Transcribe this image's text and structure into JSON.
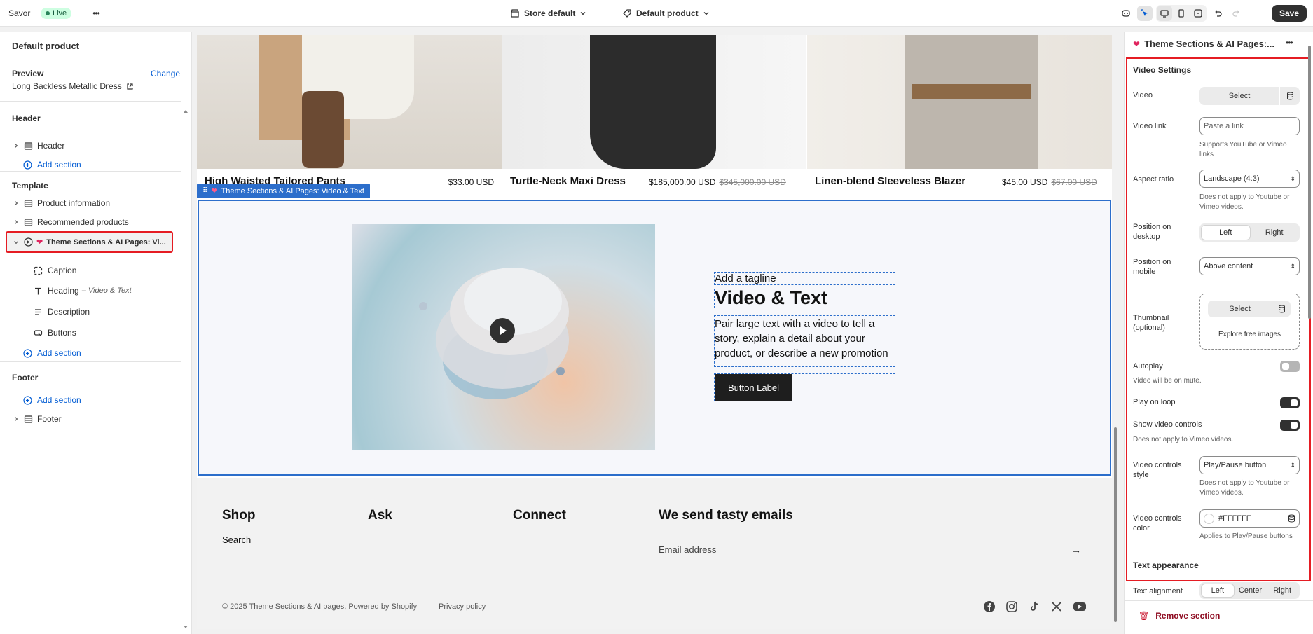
{
  "topbar": {
    "app_name": "Savor",
    "status": "Live",
    "more": "•••",
    "store": "Store default",
    "product_template": "Default product",
    "save_label": "Save"
  },
  "left_panel": {
    "title": "Default product",
    "preview_label": "Preview",
    "change_label": "Change",
    "preview_product": "Long Backless Metallic Dress",
    "header_group": "Header",
    "header_item": "Header",
    "add_section": "Add section",
    "template_group": "Template",
    "template_items": [
      "Product information",
      "Recommended products",
      "Theme Sections & AI Pages: Vi..."
    ],
    "blocks": [
      "Caption",
      "Heading",
      "Description",
      "Buttons"
    ],
    "heading_suffix": "– Video & Text",
    "footer_group": "Footer",
    "footer_item": "Footer"
  },
  "canvas": {
    "products": [
      {
        "name": "High Waisted Tailored Pants",
        "price": "$33.00 USD",
        "compare": ""
      },
      {
        "name": "Turtle-Neck Maxi Dress",
        "price": "$185,000.00 USD",
        "compare": "$345,000.00 USD"
      },
      {
        "name": "Linen-blend Sleeveless Blazer",
        "price": "$45.00 USD",
        "compare": "$67.00 USD"
      }
    ],
    "section_tag": "Theme Sections & AI Pages: Video & Text",
    "tagline": "Add a tagline",
    "heading": "Video & Text",
    "description": "Pair large text with a video to tell a story, explain a detail about your product, or describe a new promotion",
    "button_label": "Button Label",
    "footer": {
      "col1_title": "Shop",
      "col1_link": "Search",
      "col2_title": "Ask",
      "col3_title": "Connect",
      "newsletter_title": "We send tasty emails",
      "email_placeholder": "Email address",
      "copyright": "© 2025 Theme Sections & AI pages, Powered by Shopify",
      "privacy": "Privacy policy"
    },
    "social_icons": [
      "facebook-icon",
      "instagram-icon",
      "tiktok-icon",
      "x-icon",
      "youtube-icon"
    ]
  },
  "right_panel": {
    "title": "Theme Sections & AI Pages:...",
    "group_title": "Video Settings",
    "video_label": "Video",
    "select_label": "Select",
    "video_link_label": "Video link",
    "video_link_placeholder": "Paste a link",
    "video_link_help": "Supports YouTube or Vimeo links",
    "aspect_label": "Aspect ratio",
    "aspect_value": "Landscape (4:3)",
    "aspect_help": "Does not apply to Youtube or Vimeo videos.",
    "pos_desktop_label": "Position on desktop",
    "pos_left": "Left",
    "pos_right": "Right",
    "pos_mobile_label": "Position on mobile",
    "pos_mobile_value": "Above content",
    "thumb_label": "Thumbnail (optional)",
    "explore": "Explore free images",
    "autoplay_label": "Autoplay",
    "autoplay_help": "Video will be on mute.",
    "autoplay_on": false,
    "loop_label": "Play on loop",
    "loop_on": true,
    "controls_label": "Show video controls",
    "controls_on": true,
    "controls_help": "Does not apply to Vimeo videos.",
    "ctrl_style_label": "Video controls style",
    "ctrl_style_value": "Play/Pause button",
    "ctrl_style_help": "Does not apply to Youtube or Vimeo videos.",
    "ctrl_color_label": "Video controls color",
    "ctrl_color_value": "#FFFFFF",
    "ctrl_color_help": "Applies to Play/Pause buttons",
    "text_appearance": "Text appearance",
    "text_align_label": "Text alignment",
    "align_left": "Left",
    "align_center": "Center",
    "align_right": "Right",
    "remove_section": "Remove section"
  },
  "colors": {
    "highlight": "#e51c23",
    "accent": "#005bd3",
    "section_tag_bg": "#2c6ecb",
    "dark": "#303030"
  }
}
